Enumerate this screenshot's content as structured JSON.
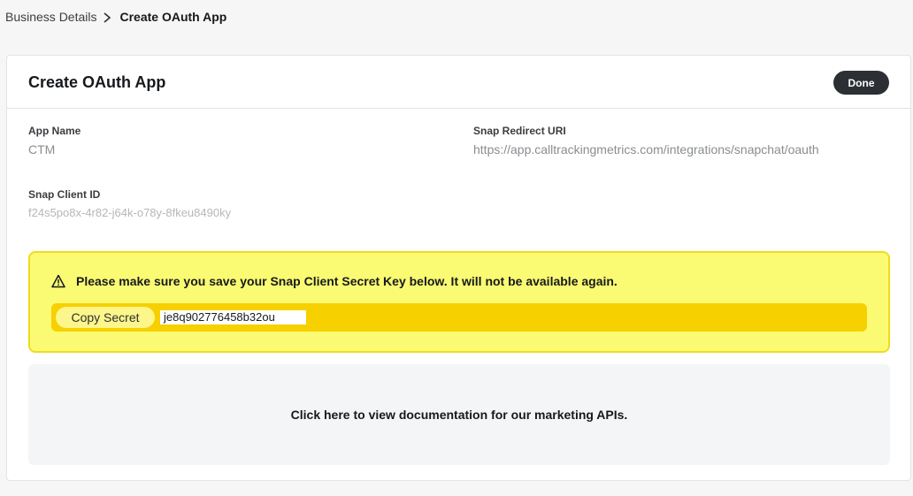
{
  "breadcrumb": {
    "parent": "Business Details",
    "current": "Create OAuth App"
  },
  "header": {
    "title": "Create OAuth App",
    "done_label": "Done"
  },
  "fields": {
    "app_name": {
      "label": "App Name",
      "value": "CTM"
    },
    "redirect_uri": {
      "label": "Snap Redirect URI",
      "value": "https://app.calltrackingmetrics.com/integrations/snapchat/oauth"
    },
    "client_id": {
      "label": "Snap Client ID",
      "value": "f24s5po8x-4r82-j64k-o78y-8fkeu8490ky"
    }
  },
  "alert": {
    "message": "Please make sure you save your Snap Client Secret Key below. It will not be available again.",
    "copy_label": "Copy Secret",
    "secret_value": "je8q902776458b32ou",
    "icon": "warning-icon"
  },
  "docs": {
    "link_text": "Click here to view documentation for our marketing APIs."
  },
  "colors": {
    "page_bg": "#f6f6f6",
    "done_bg": "#2c2f33",
    "alert_bg": "#fbfb73",
    "alert_border": "#f0dc1c",
    "secret_bar": "#f7d000"
  }
}
